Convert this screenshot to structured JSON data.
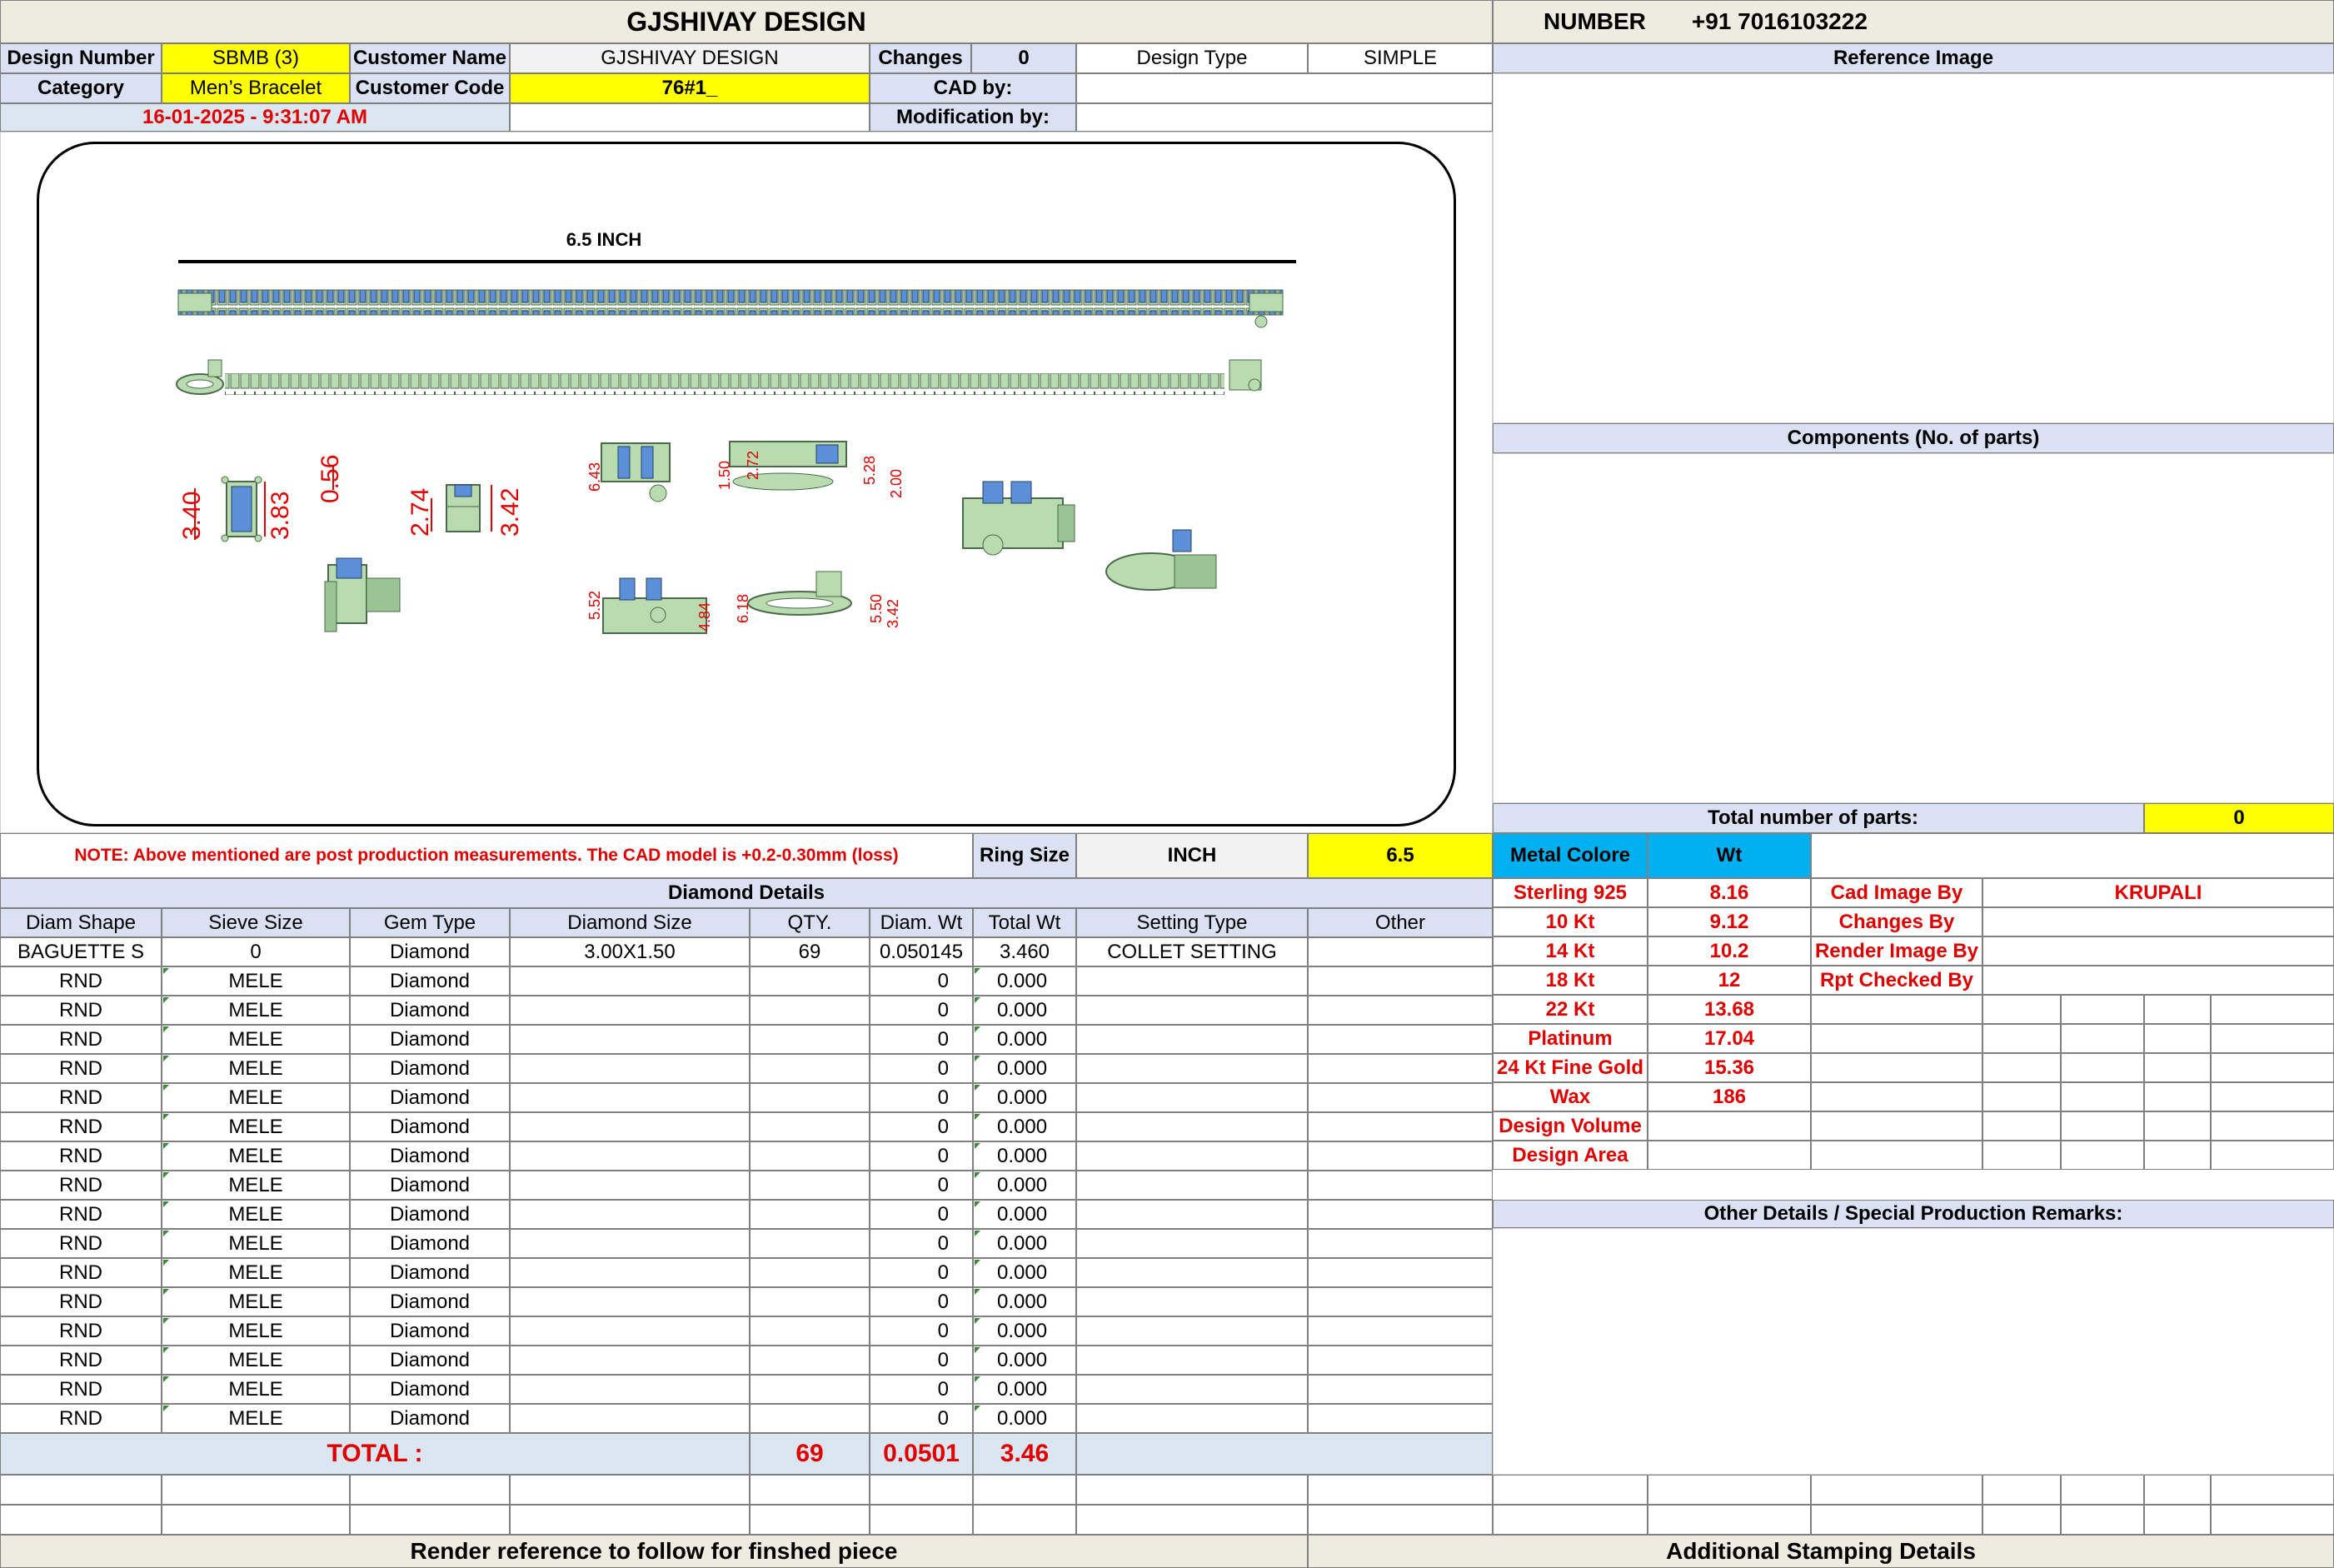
{
  "header": {
    "company": "GJSHIVAY DESIGN",
    "number_label": "NUMBER",
    "number_value": "+91 7016103222"
  },
  "info": {
    "design_number_label": "Design Number",
    "design_number": "SBMB (3)",
    "customer_name_label": "Customer Name",
    "customer_name": "GJSHIVAY DESIGN",
    "changes_label": "Changes",
    "changes_value": "0",
    "design_type_label": "Design Type",
    "design_type": "SIMPLE",
    "category_label": "Category",
    "category": "Men’s Bracelet",
    "customer_code_label": "Customer Code",
    "customer_code": "76#1_",
    "cad_by_label": "CAD by:",
    "timestamp": "16-01-2025 - 9:31:07 AM",
    "modification_label": "Modification by:"
  },
  "drawing": {
    "length_label": "6.5 INCH",
    "dims": [
      "3.40",
      "3.83",
      "0.56",
      "2.74",
      "3.42",
      "6.43",
      "1.50",
      "2.72",
      "5.28",
      "2.00",
      "5.52",
      "4.84",
      "6.18",
      "5.50",
      "3.42"
    ],
    "colors": {
      "metal": "#b8dbb0",
      "stone": "#5b8fd8",
      "dim": "#e00000"
    }
  },
  "right_panel": {
    "reference_image_label": "Reference Image",
    "components_label": "Components (No. of parts)",
    "total_parts_label": "Total number of parts:",
    "total_parts_value": "0"
  },
  "note": "NOTE: Above mentioned are post production measurements. The CAD model is +0.2-0.30mm (loss)",
  "ring": {
    "label": "Ring Size",
    "unit": "INCH",
    "value": "6.5"
  },
  "metal": {
    "color_label": "Metal Colore",
    "wt_label": "Wt",
    "rows": [
      {
        "name": "Sterling 925",
        "wt": "8.16"
      },
      {
        "name": "10 Kt",
        "wt": "9.12"
      },
      {
        "name": "14 Kt",
        "wt": "10.2"
      },
      {
        "name": "18 Kt",
        "wt": "12"
      },
      {
        "name": "22 Kt",
        "wt": "13.68"
      },
      {
        "name": "Platinum",
        "wt": "17.04"
      },
      {
        "name": "24 Kt Fine Gold",
        "wt": "15.36"
      },
      {
        "name": "Wax",
        "wt": "186"
      },
      {
        "name": "Design Volume",
        "wt": ""
      },
      {
        "name": "Design Area",
        "wt": ""
      }
    ]
  },
  "credits": [
    {
      "label": "Cad Image By",
      "value": "KRUPALI"
    },
    {
      "label": "Changes By",
      "value": ""
    },
    {
      "label": "Render Image By",
      "value": ""
    },
    {
      "label": "Rpt Checked By",
      "value": ""
    }
  ],
  "other_details_label": "Other Details / Special Production Remarks:",
  "diamond": {
    "title": "Diamond Details",
    "headers": [
      "Diam Shape",
      "Sieve Size",
      "Gem Type",
      "Diamond Size",
      "QTY.",
      "Diam. Wt",
      "Total Wt",
      "Setting Type",
      "Other"
    ],
    "rows": [
      [
        "BAGUETTE S",
        "0",
        "Diamond",
        "3.00X1.50",
        "69",
        "0.050145",
        "3.460",
        "COLLET SETTING",
        ""
      ],
      [
        "RND",
        "MELE",
        "Diamond",
        "",
        "",
        "0",
        "0.000",
        "",
        ""
      ],
      [
        "RND",
        "MELE",
        "Diamond",
        "",
        "",
        "0",
        "0.000",
        "",
        ""
      ],
      [
        "RND",
        "MELE",
        "Diamond",
        "",
        "",
        "0",
        "0.000",
        "",
        ""
      ],
      [
        "RND",
        "MELE",
        "Diamond",
        "",
        "",
        "0",
        "0.000",
        "",
        ""
      ],
      [
        "RND",
        "MELE",
        "Diamond",
        "",
        "",
        "0",
        "0.000",
        "",
        ""
      ],
      [
        "RND",
        "MELE",
        "Diamond",
        "",
        "",
        "0",
        "0.000",
        "",
        ""
      ],
      [
        "RND",
        "MELE",
        "Diamond",
        "",
        "",
        "0",
        "0.000",
        "",
        ""
      ],
      [
        "RND",
        "MELE",
        "Diamond",
        "",
        "",
        "0",
        "0.000",
        "",
        ""
      ],
      [
        "RND",
        "MELE",
        "Diamond",
        "",
        "",
        "0",
        "0.000",
        "",
        ""
      ],
      [
        "RND",
        "MELE",
        "Diamond",
        "",
        "",
        "0",
        "0.000",
        "",
        ""
      ],
      [
        "RND",
        "MELE",
        "Diamond",
        "",
        "",
        "0",
        "0.000",
        "",
        ""
      ],
      [
        "RND",
        "MELE",
        "Diamond",
        "",
        "",
        "0",
        "0.000",
        "",
        ""
      ],
      [
        "RND",
        "MELE",
        "Diamond",
        "",
        "",
        "0",
        "0.000",
        "",
        ""
      ],
      [
        "RND",
        "MELE",
        "Diamond",
        "",
        "",
        "0",
        "0.000",
        "",
        ""
      ],
      [
        "RND",
        "MELE",
        "Diamond",
        "",
        "",
        "0",
        "0.000",
        "",
        ""
      ],
      [
        "RND",
        "MELE",
        "Diamond",
        "",
        "",
        "0",
        "0.000",
        "",
        ""
      ]
    ],
    "total_label": "TOTAL :",
    "total_qty": "69",
    "total_diam_wt": "0.0501",
    "total_wt": "3.46"
  },
  "footer": {
    "render_note": "Render reference to follow for finshed piece",
    "stamping": "Additional Stamping Details"
  }
}
